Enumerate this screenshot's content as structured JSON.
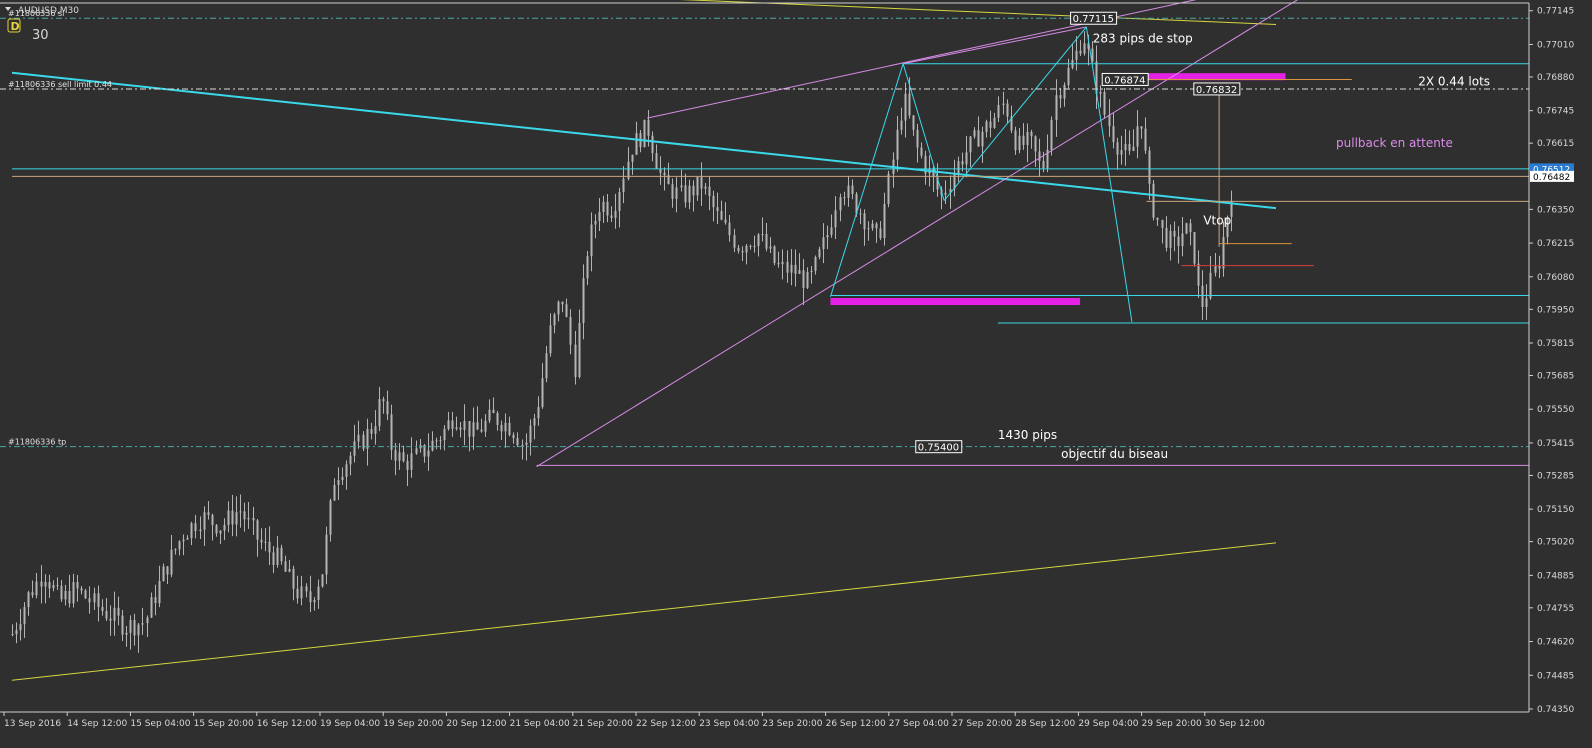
{
  "window": {
    "title": "AUDUSD,M30",
    "icon_letter": "D",
    "period_number": "30"
  },
  "colors": {
    "background": "#2f2f2f",
    "candles": "#b4b4b4",
    "cyan": "#3ad9ea",
    "violet": "#d88ce8",
    "yellow": "#d6d640",
    "magenta": "#e621e6",
    "tan": "#caa57a",
    "orange": "#d9953f",
    "red": "#e03a3a",
    "grid_dash": "#4aa7a7",
    "current_price_bg": "#2a7cd0"
  },
  "chart_data": {
    "type": "candlestick",
    "symbol": "AUDUSD",
    "timeframe": "M30",
    "ylim": [
      0.7435,
      0.7716
    ],
    "y_ticks": [
      {
        "v": 0.77145,
        "label": "0.77145"
      },
      {
        "v": 0.7701,
        "label": "0.77010"
      },
      {
        "v": 0.7688,
        "label": "0.76880"
      },
      {
        "v": 0.76745,
        "label": "0.76745"
      },
      {
        "v": 0.76615,
        "label": "0.76615"
      },
      {
        "v": 0.7635,
        "label": "0.76350"
      },
      {
        "v": 0.76215,
        "label": "0.76215"
      },
      {
        "v": 0.7608,
        "label": "0.76080"
      },
      {
        "v": 0.7595,
        "label": "0.75950"
      },
      {
        "v": 0.75815,
        "label": "0.75815"
      },
      {
        "v": 0.75685,
        "label": "0.75685"
      },
      {
        "v": 0.7555,
        "label": "0.75550"
      },
      {
        "v": 0.75415,
        "label": "0.75415"
      },
      {
        "v": 0.75285,
        "label": "0.75285"
      },
      {
        "v": 0.7515,
        "label": "0.75150"
      },
      {
        "v": 0.7502,
        "label": "0.75020"
      },
      {
        "v": 0.74885,
        "label": "0.74885"
      },
      {
        "v": 0.74755,
        "label": "0.74755"
      },
      {
        "v": 0.7462,
        "label": "0.74620"
      },
      {
        "v": 0.74485,
        "label": "0.74485"
      },
      {
        "v": 0.7435,
        "label": "0.74350"
      }
    ],
    "x_ticks": [
      {
        "t": 0,
        "label": "13 Sep 2016"
      },
      {
        "t": 1,
        "label": "14 Sep 12:00"
      },
      {
        "t": 2,
        "label": "15 Sep 04:00"
      },
      {
        "t": 3,
        "label": "15 Sep 20:00"
      },
      {
        "t": 4,
        "label": "16 Sep 12:00"
      },
      {
        "t": 5,
        "label": "19 Sep 04:00"
      },
      {
        "t": 6,
        "label": "19 Sep 20:00"
      },
      {
        "t": 7,
        "label": "20 Sep 12:00"
      },
      {
        "t": 8,
        "label": "21 Sep 04:00"
      },
      {
        "t": 9,
        "label": "21 Sep 20:00"
      },
      {
        "t": 10,
        "label": "22 Sep 12:00"
      },
      {
        "t": 11,
        "label": "23 Sep 04:00"
      },
      {
        "t": 12,
        "label": "23 Sep 20:00"
      },
      {
        "t": 13,
        "label": "26 Sep 12:00"
      },
      {
        "t": 14,
        "label": "27 Sep 04:00"
      },
      {
        "t": 15,
        "label": "27 Sep 20:00"
      },
      {
        "t": 16,
        "label": "28 Sep 12:00"
      },
      {
        "t": 17,
        "label": "29 Sep 04:00"
      },
      {
        "t": 18,
        "label": "29 Sep 20:00"
      },
      {
        "t": 19,
        "label": "30 Sep 12:00"
      }
    ],
    "price_path": [
      [
        0.0,
        0.7465
      ],
      [
        0.25,
        0.748
      ],
      [
        0.5,
        0.749
      ],
      [
        0.75,
        0.7478
      ],
      [
        1.0,
        0.7483
      ],
      [
        1.4,
        0.7475
      ],
      [
        1.8,
        0.7468
      ],
      [
        2.1,
        0.747
      ],
      [
        2.4,
        0.749
      ],
      [
        2.7,
        0.7505
      ],
      [
        3.0,
        0.7512
      ],
      [
        3.3,
        0.7508
      ],
      [
        3.6,
        0.7515
      ],
      [
        3.9,
        0.7502
      ],
      [
        4.2,
        0.7495
      ],
      [
        4.5,
        0.7482
      ],
      [
        4.7,
        0.7478
      ],
      [
        4.9,
        0.749
      ],
      [
        5.1,
        0.7528
      ],
      [
        5.4,
        0.7538
      ],
      [
        5.7,
        0.7548
      ],
      [
        5.85,
        0.756
      ],
      [
        6.0,
        0.754
      ],
      [
        6.2,
        0.7533
      ],
      [
        6.5,
        0.7538
      ],
      [
        6.8,
        0.7545
      ],
      [
        7.0,
        0.7553
      ],
      [
        7.3,
        0.7545
      ],
      [
        7.6,
        0.7552
      ],
      [
        7.9,
        0.7548
      ],
      [
        8.1,
        0.754
      ],
      [
        8.3,
        0.7555
      ],
      [
        8.5,
        0.7585
      ],
      [
        8.7,
        0.76
      ],
      [
        8.9,
        0.7572
      ],
      [
        9.1,
        0.762
      ],
      [
        9.3,
        0.7638
      ],
      [
        9.5,
        0.7635
      ],
      [
        9.8,
        0.766
      ],
      [
        10.05,
        0.7668
      ],
      [
        10.3,
        0.7645
      ],
      [
        10.6,
        0.764
      ],
      [
        10.9,
        0.7645
      ],
      [
        11.2,
        0.763
      ],
      [
        11.5,
        0.762
      ],
      [
        11.8,
        0.7625
      ],
      [
        12.1,
        0.7612
      ],
      [
        12.4,
        0.761
      ],
      [
        12.6,
        0.7605
      ],
      [
        12.9,
        0.7625
      ],
      [
        13.1,
        0.7645
      ],
      [
        13.4,
        0.7635
      ],
      [
        13.7,
        0.7622
      ],
      [
        13.9,
        0.765
      ],
      [
        14.1,
        0.768
      ],
      [
        14.3,
        0.766
      ],
      [
        14.5,
        0.765
      ],
      [
        14.7,
        0.764
      ],
      [
        15.0,
        0.7655
      ],
      [
        15.3,
        0.7665
      ],
      [
        15.5,
        0.767
      ],
      [
        15.7,
        0.7678
      ],
      [
        15.9,
        0.766
      ],
      [
        16.1,
        0.7662
      ],
      [
        16.3,
        0.765
      ],
      [
        16.5,
        0.768
      ],
      [
        16.8,
        0.7695
      ],
      [
        16.95,
        0.7705
      ],
      [
        17.1,
        0.769
      ],
      [
        17.3,
        0.7672
      ],
      [
        17.5,
        0.766
      ],
      [
        17.7,
        0.7655
      ],
      [
        17.85,
        0.7675
      ],
      [
        18.0,
        0.764
      ],
      [
        18.2,
        0.7625
      ],
      [
        18.4,
        0.762
      ],
      [
        18.55,
        0.7628
      ],
      [
        18.7,
        0.7618
      ],
      [
        18.8,
        0.7595
      ],
      [
        18.95,
        0.7605
      ],
      [
        19.1,
        0.7615
      ],
      [
        19.2,
        0.763
      ],
      [
        19.3,
        0.7645
      ]
    ],
    "tool_lines": [
      {
        "name": "yellow-upper-trendline",
        "color": "yellow",
        "width": 1,
        "points": [
          [
            7.0,
            0.77228
          ],
          [
            20.0,
            0.7709
          ]
        ]
      },
      {
        "name": "yellow-lower-trendline",
        "color": "yellow",
        "width": 1,
        "points": [
          [
            0.0,
            0.74465
          ],
          [
            20.0,
            0.75015
          ]
        ]
      },
      {
        "name": "thick-cyan-trendline",
        "color": "cyan",
        "width": 2,
        "points": [
          [
            0.0,
            0.76897
          ],
          [
            20.0,
            0.76355
          ]
        ]
      },
      {
        "name": "wedge-upper-line",
        "color": "violet",
        "width": 1,
        "points": [
          [
            10.05,
            0.76715
          ],
          [
            19.75,
            0.77245
          ]
        ]
      },
      {
        "name": "wedge-lower-line",
        "color": "violet",
        "width": 1,
        "points": [
          [
            8.3,
            0.7532
          ],
          [
            20.7,
            0.77245
          ]
        ]
      },
      {
        "name": "wedge-top-line",
        "color": "violet",
        "width": 1,
        "points": [
          [
            14.1,
            0.76933
          ],
          [
            17.0,
            0.7708
          ]
        ]
      },
      {
        "name": "target-line",
        "color": "violet",
        "width": 1,
        "points": [
          [
            8.3,
            0.75325
          ],
          [
            24.0,
            0.75325
          ]
        ]
      },
      {
        "name": "pattern-leg-1",
        "color": "cyan",
        "width": 1,
        "points": [
          [
            12.95,
            0.76
          ],
          [
            14.1,
            0.76933
          ]
        ]
      },
      {
        "name": "pattern-leg-2",
        "color": "cyan",
        "width": 1,
        "points": [
          [
            14.1,
            0.76933
          ],
          [
            14.75,
            0.76385
          ]
        ]
      },
      {
        "name": "pattern-leg-3",
        "color": "cyan",
        "width": 1,
        "points": [
          [
            14.75,
            0.76385
          ],
          [
            17.0,
            0.7708
          ]
        ]
      },
      {
        "name": "pattern-leg-4",
        "color": "cyan",
        "width": 1,
        "points": [
          [
            17.0,
            0.7708
          ],
          [
            17.72,
            0.759
          ]
        ]
      },
      {
        "name": "cyan-level-top",
        "color": "cyan",
        "width": 1,
        "points": [
          [
            14.1,
            0.76933
          ],
          [
            24.0,
            0.76933
          ]
        ]
      },
      {
        "name": "cyan-level-600",
        "color": "cyan",
        "width": 1,
        "points": [
          [
            12.95,
            0.76005
          ],
          [
            24.0,
            0.76005
          ]
        ]
      },
      {
        "name": "cyan-level-590",
        "color": "cyan",
        "width": 1,
        "points": [
          [
            15.6,
            0.75895
          ],
          [
            24.0,
            0.75895
          ]
        ]
      },
      {
        "name": "cyan-current-line",
        "color": "cyan",
        "width": 1,
        "points": [
          [
            0.0,
            0.76512
          ],
          [
            24.0,
            0.76512
          ]
        ]
      },
      {
        "name": "tan-current-line",
        "color": "tan",
        "width": 1,
        "points": [
          [
            0.0,
            0.76482
          ],
          [
            24.0,
            0.76482
          ]
        ]
      },
      {
        "name": "tan-short-line",
        "color": "tan",
        "width": 1,
        "points": [
          [
            17.95,
            0.76382
          ],
          [
            24.0,
            0.76382
          ]
        ]
      },
      {
        "name": "tan-vertical-line",
        "color": "tan",
        "width": 1,
        "points": [
          [
            19.1,
            0.7685
          ],
          [
            19.1,
            0.762
          ]
        ]
      },
      {
        "name": "orange-line-top",
        "color": "orange",
        "width": 1,
        "points": [
          [
            17.85,
            0.7687
          ],
          [
            21.2,
            0.7687
          ]
        ]
      },
      {
        "name": "orange-line-mid",
        "color": "orange",
        "width": 1,
        "points": [
          [
            19.1,
            0.76213
          ],
          [
            20.25,
            0.76213
          ]
        ]
      },
      {
        "name": "red-line",
        "color": "red",
        "width": 1,
        "points": [
          [
            18.5,
            0.76125
          ],
          [
            20.6,
            0.76125
          ]
        ]
      }
    ],
    "zones": [
      {
        "name": "magenta-zone-top",
        "t0": 17.85,
        "t1": 20.15,
        "p0": 0.76895,
        "p1": 0.76867
      },
      {
        "name": "magenta-zone-bottom",
        "t0": 12.95,
        "t1": 16.9,
        "p0": 0.75995,
        "p1": 0.75967
      }
    ],
    "dashdot_levels": [
      {
        "name": "sl-level",
        "v": 0.77115,
        "label": "#11806336 sl"
      },
      {
        "name": "sell-limit-level",
        "v": 0.76832,
        "label": "#11806336 sell limit 0.44"
      },
      {
        "name": "tp-level",
        "v": 0.754,
        "label": "#11806336 tp"
      }
    ],
    "price_boxes": [
      {
        "name": "price-box-77115",
        "t": 16.75,
        "v": 0.77115,
        "label": "0.77115"
      },
      {
        "name": "price-box-76874",
        "t": 17.25,
        "v": 0.7687,
        "label": "0.76874"
      },
      {
        "name": "price-box-76832",
        "t": 18.7,
        "v": 0.76832,
        "label": "0.76832"
      },
      {
        "name": "price-box-75400",
        "t": 14.3,
        "v": 0.754,
        "label": "0.75400"
      }
    ],
    "current_prices": [
      {
        "name": "current-bid-tag",
        "v": 0.76512,
        "label": "0.76512",
        "highlight": true
      },
      {
        "name": "current-ask-tag",
        "v": 0.76482,
        "label": "0.76482",
        "highlight": false
      }
    ],
    "annotations": [
      {
        "name": "annotation-stop",
        "text": "283 pips de stop",
        "t": 17.1,
        "v": 0.77018,
        "color": "#ffffff"
      },
      {
        "name": "annotation-lots",
        "text": "2X 0.44 lots",
        "t": 22.25,
        "v": 0.76845,
        "color": "#ffffff"
      },
      {
        "name": "annotation-pullback",
        "text": "pullback en attente",
        "t": 20.95,
        "v": 0.766,
        "color": "#d98ce8"
      },
      {
        "name": "annotation-vtop",
        "text": "Vtop",
        "t": 18.85,
        "v": 0.7629,
        "color": "#ffffff"
      },
      {
        "name": "annotation-pips",
        "text": "1430 pips",
        "t": 15.6,
        "v": 0.7543,
        "color": "#ffffff"
      },
      {
        "name": "annotation-objectif",
        "text": "objectif du biseau",
        "t": 16.6,
        "v": 0.75354,
        "color": "#ffffff"
      }
    ]
  }
}
